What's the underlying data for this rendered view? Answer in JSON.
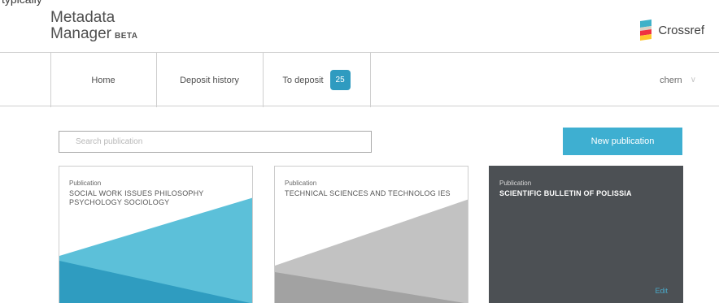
{
  "top_clip_text": "typically",
  "app": {
    "name_line1": "Metadata",
    "name_line2": "Manager",
    "beta": "BETA"
  },
  "brand": {
    "name": "Crossref",
    "icon": "crossref-logo-icon",
    "colors": [
      "#3eb1c8",
      "#d8d2c4",
      "#ef3340",
      "#ffc72c"
    ]
  },
  "nav": {
    "home": "Home",
    "deposit_history": "Deposit history",
    "to_deposit": "To deposit",
    "to_deposit_count": "25",
    "user": "chern",
    "user_menu_icon": "chevron-down-icon"
  },
  "search": {
    "placeholder": "Search publication",
    "value": ""
  },
  "new_publication": "New publication",
  "publications": [
    {
      "type": "Publication",
      "title": "SOCIAL WORK ISSUES PHILOSOPHY PSYCHOLOGY SOCIOLOGY",
      "style": "blue"
    },
    {
      "type": "Publication",
      "title": "TECHNICAL SCIENCES AND TECHNOLOG IES",
      "style": "gray"
    },
    {
      "type": "Publication",
      "title": "SCIENTIFIC BULLETIN OF POLISSIA",
      "style": "dark",
      "action": "Edit"
    }
  ],
  "colors": {
    "accent": "#3eafd1",
    "badge": "#2f9bc0",
    "dark_card": "#4c5054"
  }
}
